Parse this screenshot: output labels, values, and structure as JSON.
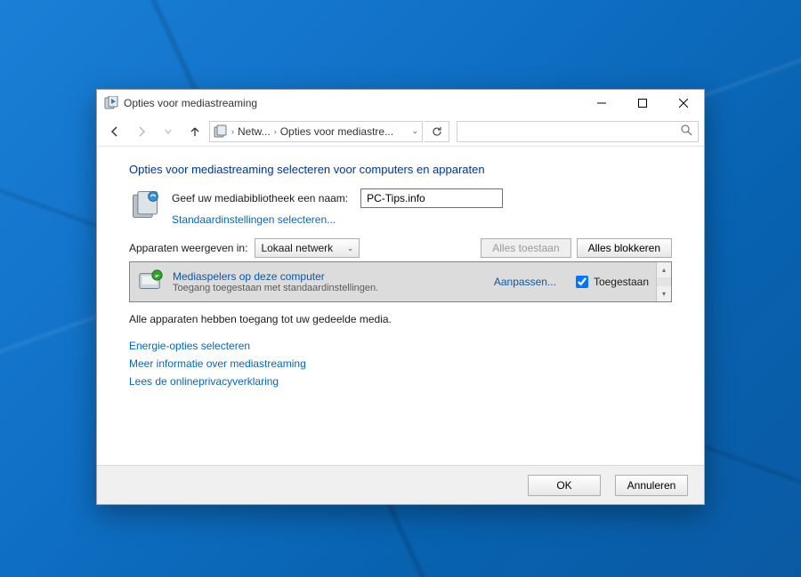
{
  "window": {
    "title": "Opties voor mediastreaming"
  },
  "nav": {
    "back_enabled": true,
    "forward_enabled": false,
    "up_enabled": true,
    "breadcrumb": {
      "item1": "Netw...",
      "item2": "Opties voor mediastre..."
    }
  },
  "heading": "Opties voor mediastreaming selecteren voor computers en apparaten",
  "library": {
    "name_label": "Geef uw mediabibliotheek een naam:",
    "name_value": "PC-Tips.info",
    "defaults_link": "Standaardinstellingen selecteren..."
  },
  "devices": {
    "show_label": "Apparaten weergeven in:",
    "scope_selected": "Lokaal netwerk",
    "allow_all_label": "Alles toestaan",
    "block_all_label": "Alles blokkeren",
    "list": [
      {
        "title": "Mediaspelers op deze computer",
        "subtitle": "Toegang toegestaan met standaardinstellingen.",
        "customize": "Aanpassen...",
        "allowed_label": "Toegestaan",
        "allowed": true
      }
    ]
  },
  "status": "Alle apparaten hebben toegang tot uw gedeelde media.",
  "links": {
    "energy": "Energie-opties selecteren",
    "more_info": "Meer informatie over mediastreaming",
    "privacy": "Lees de onlineprivacyverklaring"
  },
  "footer": {
    "ok": "OK",
    "cancel": "Annuleren"
  }
}
